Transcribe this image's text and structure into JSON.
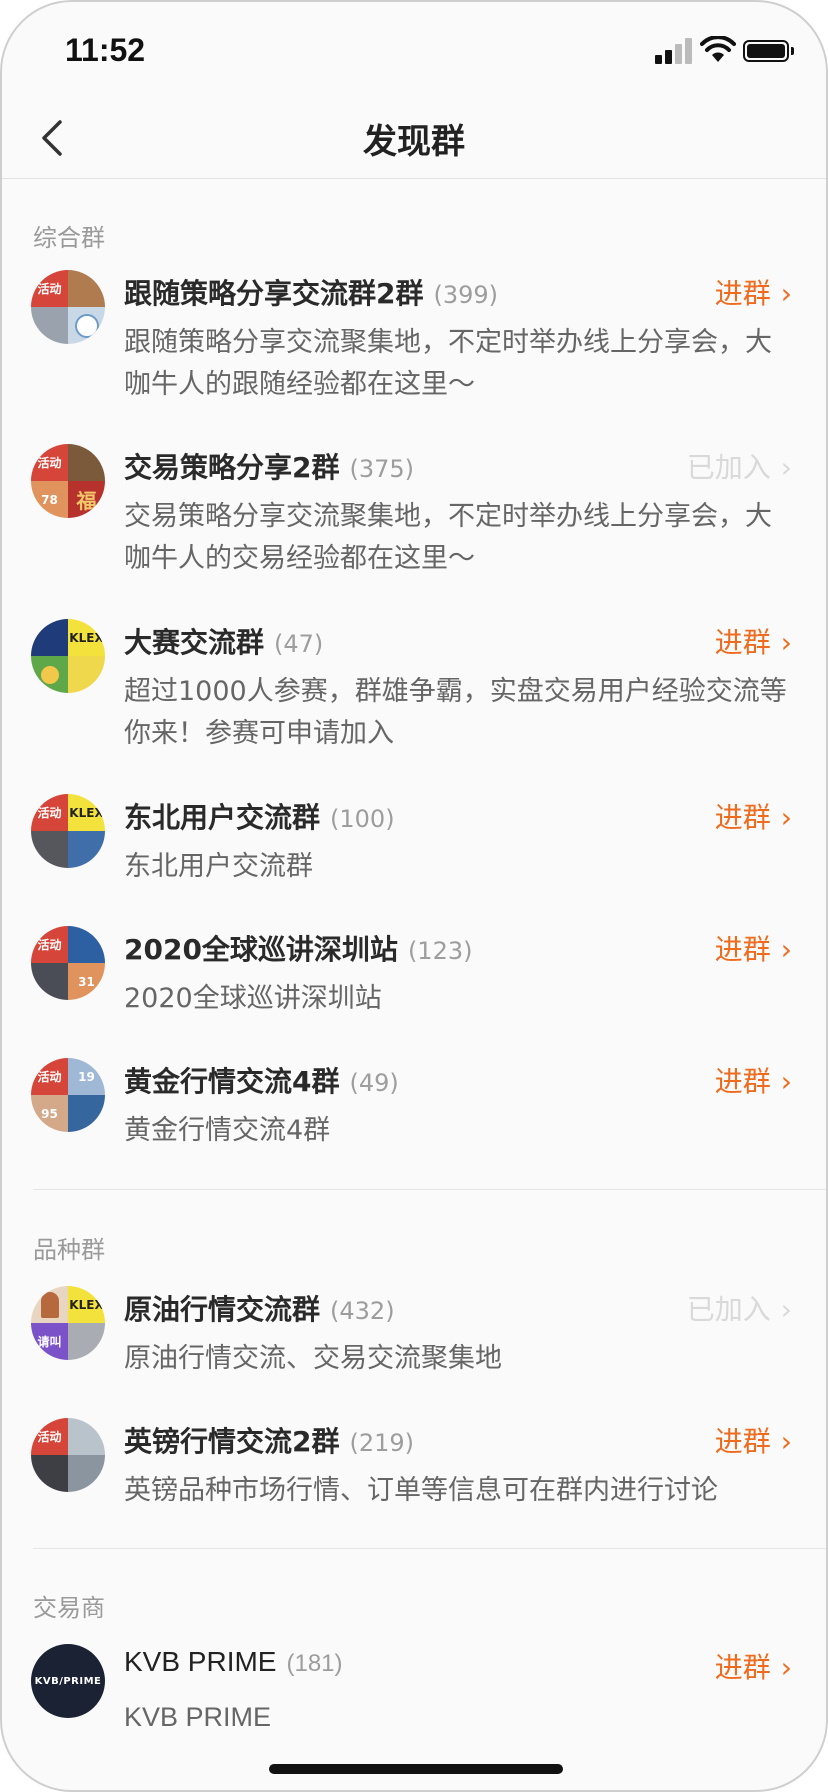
{
  "status_bar": {
    "time": "11:52"
  },
  "nav": {
    "title": "发现群",
    "back_icon": "chevron-left-icon"
  },
  "action_labels": {
    "join": "进群",
    "joined": "已加入"
  },
  "sections": [
    {
      "label": "综合群",
      "groups": [
        {
          "name": "跟随策略分享交流群2群",
          "count": "(399)",
          "desc": "跟随策略分享交流聚集地，不定时举办线上分享会，大咖牛人的跟随经验都在这里～",
          "status": "join",
          "avatar_text": [
            "活动",
            "",
            "",
            ""
          ]
        },
        {
          "name": "交易策略分享2群",
          "count": "(375)",
          "desc": "交易策略分享交流聚集地，不定时举办线上分享会，大咖牛人的交易经验都在这里～",
          "status": "joined",
          "avatar_text": [
            "活动",
            "",
            "78",
            "福"
          ]
        },
        {
          "name": "大赛交流群",
          "count": "(47)",
          "desc": "超过1000人参赛，群雄争霸，实盘交易用户经验交流等你来！参赛可申请加入",
          "status": "join",
          "avatar_text": [
            "",
            "KLEX",
            "",
            ""
          ]
        },
        {
          "name": "东北用户交流群",
          "count": "(100)",
          "desc": "东北用户交流群",
          "status": "join",
          "avatar_text": [
            "活动",
            "KLEX",
            "",
            ""
          ]
        },
        {
          "name": "2020全球巡讲深圳站",
          "count": "(123)",
          "desc": "2020全球巡讲深圳站",
          "status": "join",
          "avatar_text": [
            "活动",
            "",
            "",
            "31"
          ]
        },
        {
          "name": "黄金行情交流4群",
          "count": "(49)",
          "desc": "黄金行情交流4群",
          "status": "join",
          "avatar_text": [
            "活动",
            "19",
            "95",
            ""
          ]
        }
      ]
    },
    {
      "label": "品种群",
      "groups": [
        {
          "name": "原油行情交流群",
          "count": "(432)",
          "desc": "原油行情交流、交易交流聚集地",
          "status": "joined",
          "avatar_text": [
            "",
            "KLEX",
            "请叫",
            ""
          ]
        },
        {
          "name": "英镑行情交流2群",
          "count": "(219)",
          "desc": "英镑品种市场行情、订单等信息可在群内进行讨论",
          "status": "join",
          "avatar_text": [
            "活动",
            "",
            "",
            ""
          ]
        }
      ]
    },
    {
      "label": "交易商",
      "groups": [
        {
          "name": "KVB PRIME",
          "count": "(181)",
          "desc": "KVB PRIME",
          "status": "join",
          "avatar_text": [
            "KVB/PRIME"
          ]
        }
      ]
    }
  ],
  "colors": {
    "accent": "#ef6c1f",
    "joined": "#d9d9d9",
    "section_label": "#9a9a9a"
  }
}
